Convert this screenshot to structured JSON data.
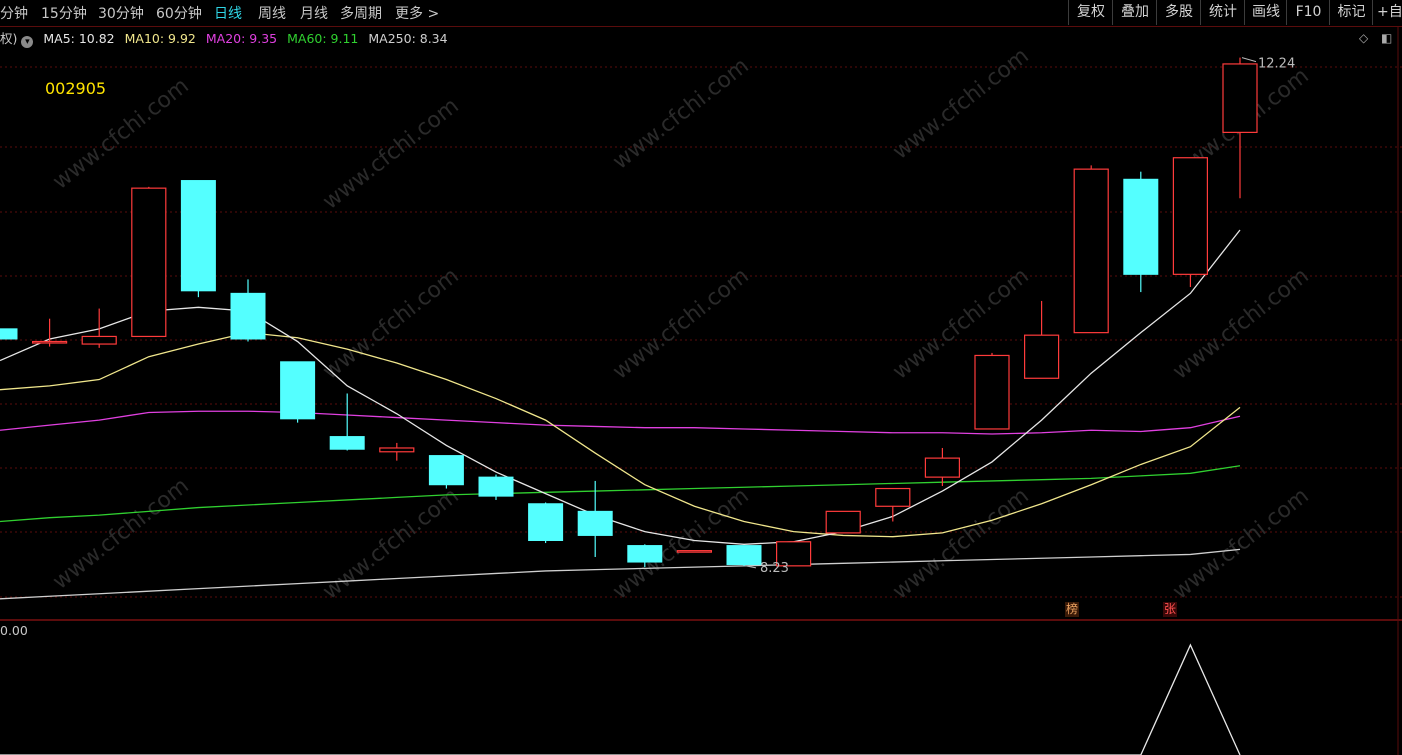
{
  "tabs": [
    {
      "label": "分钟",
      "active": false
    },
    {
      "label": "15分钟",
      "active": false
    },
    {
      "label": "30分钟",
      "active": false
    },
    {
      "label": "60分钟",
      "active": false
    },
    {
      "label": "日线",
      "active": true
    },
    {
      "label": "周线",
      "active": false
    },
    {
      "label": "月线",
      "active": false
    },
    {
      "label": "多周期",
      "active": false
    },
    {
      "label": "更多 >",
      "active": false
    }
  ],
  "right_buttons": [
    "复权",
    "叠加",
    "多股",
    "统计",
    "画线",
    "F10",
    "标记",
    "+自"
  ],
  "ma_bar": {
    "prefix": "权)",
    "dot_icon": "chevron-down-icon",
    "items": [
      {
        "label": "MA5: 10.82",
        "color": "#e6e6e6"
      },
      {
        "label": "MA10: 9.92",
        "color": "#f0e68c"
      },
      {
        "label": "MA20: 9.35",
        "color": "#e040e0"
      },
      {
        "label": "MA60: 9.11",
        "color": "#30d030"
      },
      {
        "label": "MA250: 8.34",
        "color": "#cfcfcf"
      }
    ]
  },
  "stock_code": "002905",
  "watermark": "www.cfchi.com",
  "sub_value": "0.00",
  "badges": [
    {
      "text": "榜",
      "color": "#e8a060",
      "bg": "#3a1a08"
    },
    {
      "text": "张",
      "color": "#ff5050",
      "bg": "#3a0808"
    }
  ],
  "colors": {
    "up": "#ff3b3b",
    "down": "#54ffff",
    "grid": "#5a0c0c",
    "bg": "#000000"
  },
  "chart_data": {
    "type": "candlestick",
    "high_label": "12.24",
    "low_label": "8.23",
    "ylim": [
      8.0,
      12.3
    ],
    "candles": [
      {
        "o": 10.1,
        "h": 10.1,
        "l": 10.02,
        "c": 10.02
      },
      {
        "o": 10.0,
        "h": 10.18,
        "l": 9.96,
        "c": 10.0
      },
      {
        "o": 9.98,
        "h": 10.26,
        "l": 9.95,
        "c": 10.04
      },
      {
        "o": 10.04,
        "h": 11.22,
        "l": 10.04,
        "c": 11.21
      },
      {
        "o": 11.27,
        "h": 11.27,
        "l": 10.35,
        "c": 10.4
      },
      {
        "o": 10.38,
        "h": 10.49,
        "l": 10.0,
        "c": 10.02
      },
      {
        "o": 9.84,
        "h": 9.84,
        "l": 9.36,
        "c": 9.39
      },
      {
        "o": 9.25,
        "h": 9.59,
        "l": 9.14,
        "c": 9.15
      },
      {
        "o": 9.13,
        "h": 9.2,
        "l": 9.06,
        "c": 9.16
      },
      {
        "o": 9.1,
        "h": 9.1,
        "l": 8.84,
        "c": 8.87
      },
      {
        "o": 8.93,
        "h": 8.95,
        "l": 8.75,
        "c": 8.78
      },
      {
        "o": 8.72,
        "h": 8.73,
        "l": 8.41,
        "c": 8.43
      },
      {
        "o": 8.66,
        "h": 8.9,
        "l": 8.3,
        "c": 8.47
      },
      {
        "o": 8.39,
        "h": 8.4,
        "l": 8.22,
        "c": 8.26
      },
      {
        "o": 8.34,
        "h": 8.35,
        "l": 8.34,
        "c": 8.35
      },
      {
        "o": 8.39,
        "h": 8.39,
        "l": 8.23,
        "c": 8.24
      },
      {
        "o": 8.23,
        "h": 8.42,
        "l": 8.23,
        "c": 8.42
      },
      {
        "o": 8.49,
        "h": 8.65,
        "l": 8.49,
        "c": 8.66
      },
      {
        "o": 8.7,
        "h": 8.83,
        "l": 8.58,
        "c": 8.84
      },
      {
        "o": 8.93,
        "h": 9.16,
        "l": 8.86,
        "c": 9.08
      },
      {
        "o": 9.31,
        "h": 9.91,
        "l": 9.31,
        "c": 9.89
      },
      {
        "o": 9.71,
        "h": 10.32,
        "l": 9.71,
        "c": 10.05
      },
      {
        "o": 10.07,
        "h": 11.39,
        "l": 10.07,
        "c": 11.36
      },
      {
        "o": 11.28,
        "h": 11.34,
        "l": 10.39,
        "c": 10.53
      },
      {
        "o": 10.53,
        "h": 11.36,
        "l": 10.43,
        "c": 11.45
      },
      {
        "o": 11.65,
        "h": 12.24,
        "l": 11.13,
        "c": 12.19
      }
    ],
    "ma5": [
      9.85,
      10.02,
      10.1,
      10.24,
      10.27,
      10.24,
      10.0,
      9.65,
      9.43,
      9.18,
      8.97,
      8.8,
      8.63,
      8.5,
      8.43,
      8.4,
      8.42,
      8.5,
      8.62,
      8.82,
      9.05,
      9.38,
      9.75,
      10.07,
      10.38,
      10.88
    ],
    "ma10": [
      9.62,
      9.65,
      9.7,
      9.88,
      9.98,
      10.07,
      10.03,
      9.94,
      9.83,
      9.7,
      9.55,
      9.38,
      9.12,
      8.87,
      8.7,
      8.58,
      8.5,
      8.47,
      8.46,
      8.49,
      8.59,
      8.72,
      8.87,
      9.03,
      9.17,
      9.48
    ],
    "ma20": [
      9.3,
      9.34,
      9.38,
      9.44,
      9.45,
      9.45,
      9.44,
      9.42,
      9.4,
      9.38,
      9.36,
      9.34,
      9.33,
      9.32,
      9.32,
      9.31,
      9.3,
      9.29,
      9.28,
      9.28,
      9.27,
      9.28,
      9.3,
      9.29,
      9.32,
      9.41
    ],
    "ma60": [
      8.58,
      8.61,
      8.63,
      8.66,
      8.69,
      8.71,
      8.73,
      8.75,
      8.77,
      8.79,
      8.8,
      8.81,
      8.82,
      8.83,
      8.84,
      8.85,
      8.86,
      8.87,
      8.88,
      8.89,
      8.9,
      8.91,
      8.92,
      8.94,
      8.96,
      9.02
    ],
    "ma250": [
      7.97,
      7.99,
      8.01,
      8.03,
      8.05,
      8.07,
      8.09,
      8.11,
      8.13,
      8.15,
      8.17,
      8.19,
      8.2,
      8.21,
      8.22,
      8.23,
      8.24,
      8.25,
      8.26,
      8.27,
      8.28,
      8.29,
      8.3,
      8.31,
      8.32,
      8.36
    ],
    "indicator": [
      0,
      0,
      0,
      0,
      0,
      0,
      0,
      0,
      0,
      0,
      0,
      0,
      0,
      0,
      0,
      0,
      0,
      0,
      0,
      0,
      0,
      0,
      0,
      0,
      1,
      0
    ]
  }
}
